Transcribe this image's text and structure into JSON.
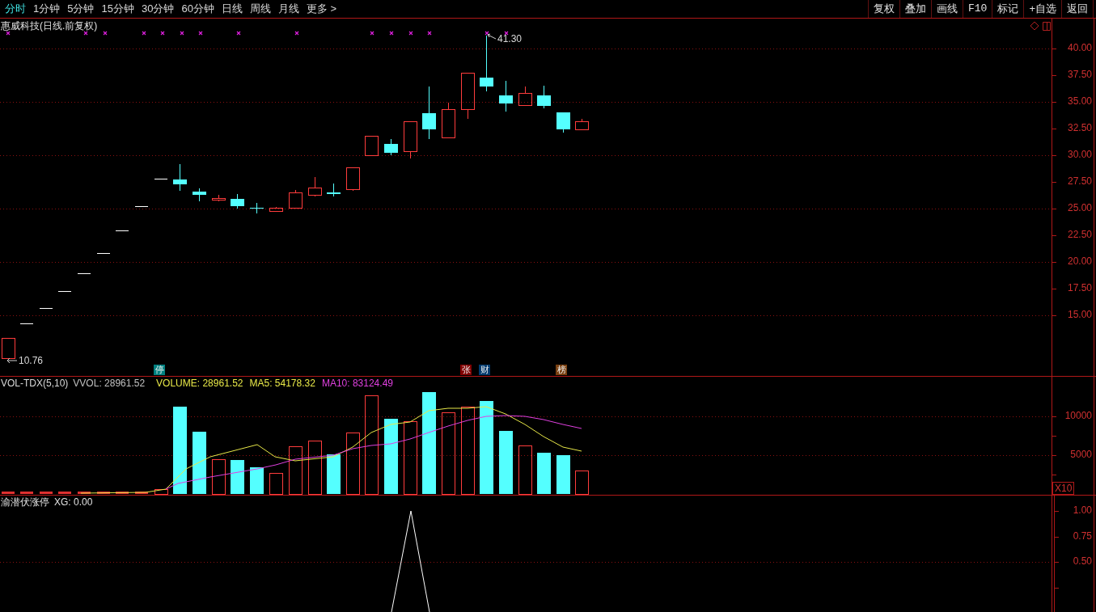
{
  "toolbar": {
    "periods": [
      {
        "label": "分时",
        "selected": true
      },
      {
        "label": "1分钟",
        "selected": false
      },
      {
        "label": "5分钟",
        "selected": false
      },
      {
        "label": "15分钟",
        "selected": false
      },
      {
        "label": "30分钟",
        "selected": false
      },
      {
        "label": "60分钟",
        "selected": false
      },
      {
        "label": "日线",
        "selected": false
      },
      {
        "label": "周线",
        "selected": false
      },
      {
        "label": "月线",
        "selected": false
      },
      {
        "label": "更多 >",
        "selected": false
      }
    ],
    "actions": [
      "复权",
      "叠加",
      "画线",
      "F10",
      "标记",
      "+自选",
      "返回"
    ]
  },
  "price_panel": {
    "title": "惠威科技(日线.前复权)",
    "high_label": "41.30",
    "low_label": "10.76",
    "axis_labels": [
      "40.00",
      "37.50",
      "35.00",
      "32.50",
      "30.00",
      "27.50",
      "25.00",
      "22.50",
      "20.00",
      "17.50",
      "15.00"
    ],
    "event_tags": [
      {
        "label": "停",
        "color": "#008080"
      },
      {
        "label": "张",
        "color": "#800000"
      },
      {
        "label": "财",
        "color": "#003a6e"
      },
      {
        "label": "榜",
        "color": "#7a4010"
      }
    ]
  },
  "volume_panel": {
    "indicator": "VOL-TDX(5,10)",
    "readings": [
      {
        "text": "VVOL: 28961.52",
        "color": "#c0c0c0"
      },
      {
        "text": "VOLUME: 28961.52",
        "color": "#e8e848"
      },
      {
        "text": "MA5: 54178.32",
        "color": "#e8e848"
      },
      {
        "text": "MA10: 83124.49",
        "color": "#e040e0"
      }
    ],
    "axis_labels": [
      "10000",
      "5000"
    ],
    "scale": "X10"
  },
  "xg_panel": {
    "title": "渝潜伏涨停",
    "reading": "XG: 0.00",
    "axis_labels": [
      "1.00",
      "0.75",
      "0.50"
    ]
  }
}
